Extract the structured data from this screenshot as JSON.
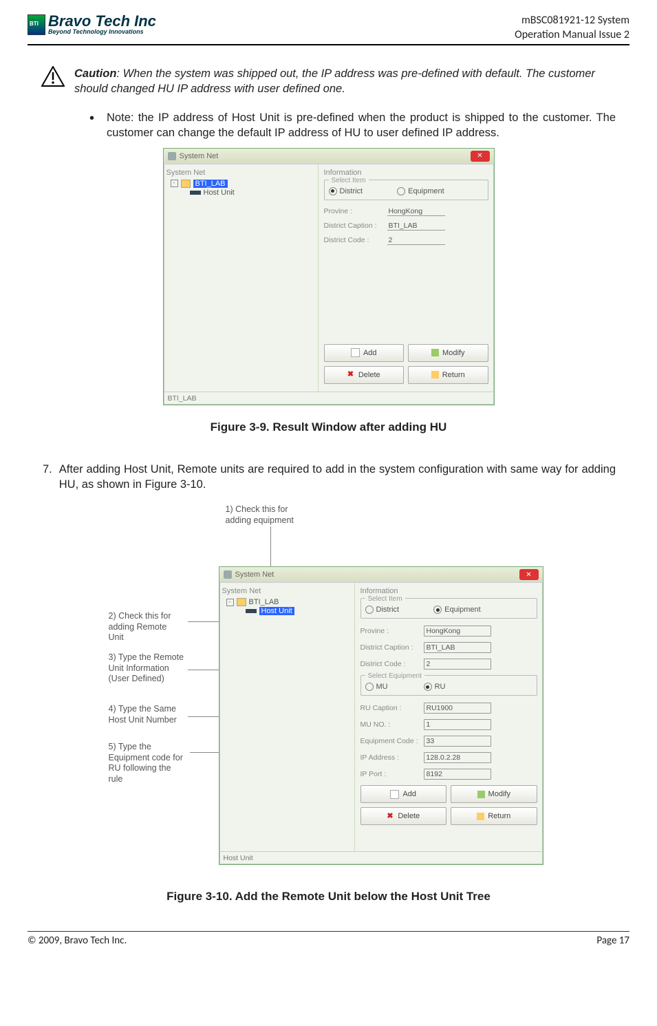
{
  "header": {
    "logo_line1": "Bravo Tech Inc",
    "logo_line2": "Beyond Technology Innovations",
    "doc_line1": "mBSC081921-12 System",
    "doc_line2": "Operation Manual Issue 2"
  },
  "caution": {
    "label": "Caution",
    "text": ": When the system was shipped out, the IP address was pre-defined with default. The customer should changed HU IP address with user defined one."
  },
  "bullet_note": "Note: the IP address of Host Unit is pre-defined when the product is shipped to the customer. The customer can change the default IP address of HU to user defined IP address.",
  "fig9": {
    "window_title": "System Net",
    "left_title": "System Net",
    "tree_root": "BTI_LAB",
    "tree_child": "Host Unit",
    "right_title": "Information",
    "select_item_label": "Select Item",
    "radio_district": "District",
    "radio_equipment": "Equipment",
    "fields": {
      "province_lbl": "Provine :",
      "province_val": "HongKong",
      "caption_lbl": "District Caption :",
      "caption_val": "BTI_LAB",
      "code_lbl": "District Code :",
      "code_val": "2"
    },
    "buttons": {
      "add": "Add",
      "modify": "Modify",
      "delete": "Delete",
      "return": "Return"
    },
    "status": "BTI_LAB",
    "caption": "Figure 3-9. Result Window after adding HU"
  },
  "step7": {
    "num": "7.",
    "text": "After adding Host Unit, Remote units are required to add in the system configuration with same way for adding HU, as shown in Figure 3-10."
  },
  "fig10": {
    "ann1": "1) Check this for adding equipment",
    "ann2": "2) Check this for adding Remote Unit",
    "ann3": "3) Type the Remote Unit Information (User Defined)",
    "ann4": "4) Type the Same Host Unit Number",
    "ann5": "5) Type the Equipment code for RU following the rule",
    "window_title": "System Net",
    "left_title": "System Net",
    "tree_root": "BTI_LAB",
    "tree_child": "Host Unit",
    "right_title": "Information",
    "select_item_label": "Select Item",
    "radio_district": "District",
    "radio_equipment": "Equipment",
    "fields": {
      "province_lbl": "Provine :",
      "province_val": "HongKong",
      "caption_lbl": "District Caption :",
      "caption_val": "BTI_LAB",
      "code_lbl": "District Code :",
      "code_val": "2"
    },
    "select_equip_label": "Select Equipment",
    "radio_mu": "MU",
    "radio_ru": "RU",
    "equip_fields": {
      "ru_caption_lbl": "RU Caption :",
      "ru_caption_val": "RU1900",
      "mu_no_lbl": "MU NO. :",
      "mu_no_val": "1",
      "eq_code_lbl": "Equipment Code :",
      "eq_code_val": "33",
      "ip_addr_lbl": "IP Address :",
      "ip_addr_val": "128.0.2.28",
      "ip_port_lbl": "IP Port :",
      "ip_port_val": "8192"
    },
    "buttons": {
      "add": "Add",
      "modify": "Modify",
      "delete": "Delete",
      "return": "Return"
    },
    "status": "Host Unit",
    "caption": "Figure 3-10. Add the Remote Unit below the Host Unit Tree"
  },
  "footer": {
    "left": "© 2009, Bravo Tech Inc.",
    "right": "Page 17"
  }
}
